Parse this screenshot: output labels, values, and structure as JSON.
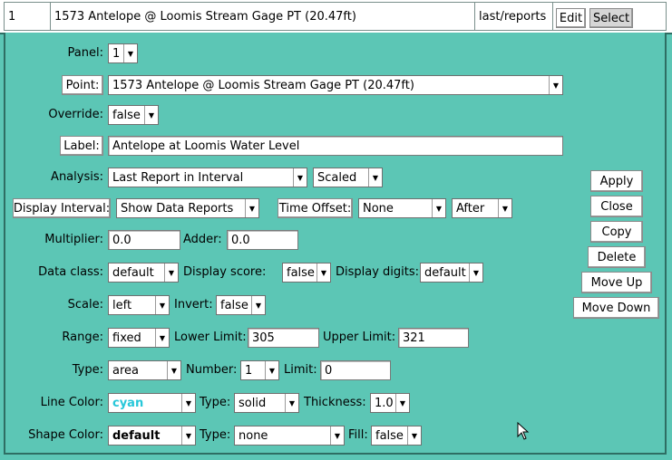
{
  "header": {
    "index": "1",
    "title": "1573 Antelope @ Loomis Stream Gage PT (20.47ft)",
    "source": "last/reports",
    "edit_label": "Edit",
    "select_label": "Select"
  },
  "form": {
    "panel": {
      "label": "Panel:",
      "value": "1"
    },
    "point": {
      "label": "Point:",
      "value": "1573 Antelope @ Loomis Stream Gage PT (20.47ft)"
    },
    "override": {
      "label": "Override:",
      "value": "false"
    },
    "label_field": {
      "label": "Label:",
      "value": "Antelope at Loomis Water Level"
    },
    "analysis": {
      "label": "Analysis:",
      "value": "Last Report in Interval",
      "scale_value": "Scaled"
    },
    "display_interval": {
      "label": "Display Interval:",
      "value": "Show Data Reports"
    },
    "time_offset": {
      "label": "Time Offset:",
      "value": "None",
      "position": "After"
    },
    "multiplier": {
      "label": "Multiplier:",
      "value": "0.0"
    },
    "adder": {
      "label": "Adder:",
      "value": "0.0"
    },
    "data_class": {
      "label": "Data class:",
      "value": "default"
    },
    "display_score": {
      "label": "Display score:",
      "value": "false"
    },
    "display_digits": {
      "label": "Display digits:",
      "value": "default"
    },
    "scale": {
      "label": "Scale:",
      "value": "left"
    },
    "invert": {
      "label": "Invert:",
      "value": "false"
    },
    "range": {
      "label": "Range:",
      "value": "fixed"
    },
    "lower_limit": {
      "label": "Lower Limit:",
      "value": "305"
    },
    "upper_limit": {
      "label": "Upper Limit:",
      "value": "321"
    },
    "type": {
      "label": "Type:",
      "value": "area"
    },
    "number": {
      "label": "Number:",
      "value": "1"
    },
    "limit": {
      "label": "Limit:",
      "value": "0"
    },
    "line_color": {
      "label": "Line Color:",
      "value": "cyan",
      "type_label": "Type:",
      "type_value": "solid",
      "thickness_label": "Thickness:",
      "thickness_value": "1.0"
    },
    "shape_color": {
      "label": "Shape Color:",
      "value": "default",
      "type_label": "Type:",
      "type_value": "none",
      "fill_label": "Fill:",
      "fill_value": "false"
    }
  },
  "actions": {
    "apply": "Apply",
    "close": "Close",
    "copy": "Copy",
    "delete": "Delete",
    "move_up": "Move Up",
    "move_down": "Move Down"
  },
  "colors": {
    "background": "#5cc6b5",
    "cyan": "#27c7d9",
    "border": "#2e6e63"
  }
}
